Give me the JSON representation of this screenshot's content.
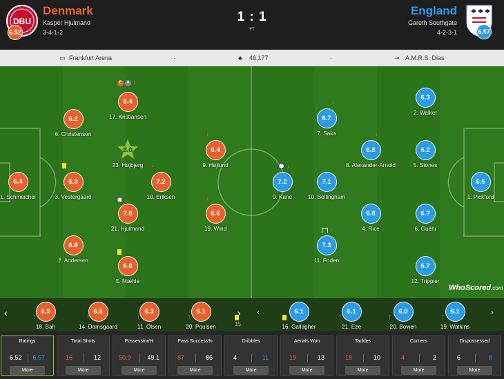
{
  "match": {
    "home": {
      "name": "Denmark",
      "coach": "Kasper Hjulmand",
      "formation": "3-4-1-2",
      "rating": "6.52",
      "crest_text": "DBU",
      "color": "#e8612c"
    },
    "away": {
      "name": "England",
      "coach": "Gareth Southgate",
      "formation": "4-2-3-1",
      "rating": "6.57",
      "color": "#2b9ae8"
    },
    "score": "1 : 1",
    "status": "FT"
  },
  "info": {
    "venue": "Frankfurt Arena",
    "attendance": "46,177",
    "referee": "A.M.R.S. Dias",
    "sep1": "·",
    "sep2": "·"
  },
  "home_players": [
    {
      "name": "17. Kristiansen",
      "rating": "5.4"
    },
    {
      "name": "6. Christensen",
      "rating": "6.2"
    },
    {
      "name": "23. Højbjerg",
      "rating": "8.0"
    },
    {
      "name": "9. Højlund",
      "rating": "6.4"
    },
    {
      "name": "1. Schmeichel",
      "rating": "6.4"
    },
    {
      "name": "3. Vestergaard",
      "rating": "6.3"
    },
    {
      "name": "10. Eriksen",
      "rating": "7.2"
    },
    {
      "name": "21. Hjulmand",
      "rating": "7.0"
    },
    {
      "name": "19. Wind",
      "rating": "6.6"
    },
    {
      "name": "2. Andersen",
      "rating": "6.8"
    },
    {
      "name": "5. Mæhle",
      "rating": "6.8"
    }
  ],
  "away_players": [
    {
      "name": "2. Walker",
      "rating": "6.3"
    },
    {
      "name": "7. Saka",
      "rating": "6.7"
    },
    {
      "name": "8. Alexander-Arnold",
      "rating": "6.8"
    },
    {
      "name": "5. Stones",
      "rating": "6.2"
    },
    {
      "name": "9. Kane",
      "rating": "7.2"
    },
    {
      "name": "10. Bellingham",
      "rating": "7.1"
    },
    {
      "name": "1. Pickford",
      "rating": "6.6"
    },
    {
      "name": "4. Rice",
      "rating": "6.8"
    },
    {
      "name": "6. Guéhi",
      "rating": "6.7"
    },
    {
      "name": "11. Foden",
      "rating": "7.3"
    },
    {
      "name": "12. Trippier",
      "rating": "6.7"
    }
  ],
  "badges": {
    "e": "E",
    "a": "A"
  },
  "watermark": "WhoScored",
  "watermark_suffix": ".com",
  "subs": {
    "home": [
      {
        "name": "18. Bah",
        "rating": "6.5"
      },
      {
        "name": "14. Damsgaard",
        "rating": "6.6"
      },
      {
        "name": "11. Olsen",
        "rating": "6.3"
      },
      {
        "name": "20. Poulsen",
        "rating": "6.1"
      },
      {
        "name": "15."
      }
    ],
    "away": [
      {
        "name": "16. Gallagher",
        "rating": "6.1"
      },
      {
        "name": "21. Eze",
        "rating": "6.1"
      },
      {
        "name": "20. Bowen",
        "rating": "6.0"
      },
      {
        "name": "19. Watkins",
        "rating": "6.1"
      }
    ]
  },
  "stats": [
    {
      "title": "Ratings",
      "home": "6.52",
      "away": "6.57",
      "more": "More"
    },
    {
      "title": "Total Shots",
      "home": "16",
      "away": "12",
      "more": "More"
    },
    {
      "title": "Possession%",
      "home": "50.9",
      "away": "49.1",
      "more": "More"
    },
    {
      "title": "Pass Success%",
      "home": "87",
      "away": "86",
      "more": "More"
    },
    {
      "title": "Dribbles",
      "home": "4",
      "away": "11",
      "more": "More"
    },
    {
      "title": "Aerials Won",
      "home": "19",
      "away": "13",
      "more": "More"
    },
    {
      "title": "Tackles",
      "home": "18",
      "away": "10",
      "more": "More"
    },
    {
      "title": "Corners",
      "home": "4",
      "away": "2",
      "more": "More"
    },
    {
      "title": "Dispossessed",
      "home": "6",
      "away": "8",
      "more": "More"
    }
  ],
  "icons": {
    "stadium": "stadium-icon",
    "crowd": "crowd-icon",
    "whistle": "whistle-icon"
  },
  "colors": {
    "home": "#e8612c",
    "away": "#2b9ae8",
    "pitch": "#2f7a1c",
    "highlight": "#8ac53b"
  }
}
